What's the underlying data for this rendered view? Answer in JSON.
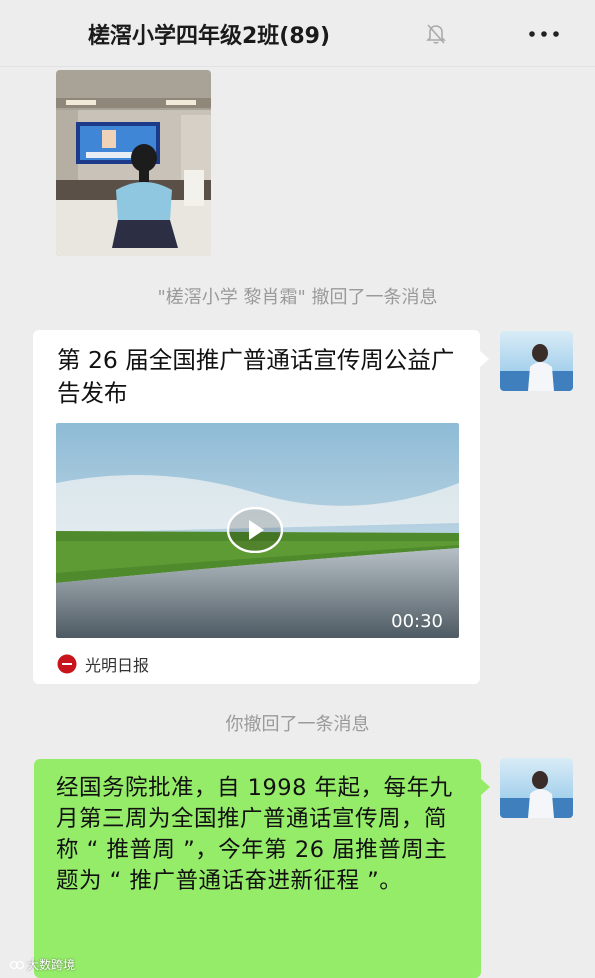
{
  "header": {
    "title": "槎滘小学四年级2班(89)",
    "mute_icon": "mute-bell-icon",
    "more_icon": "more-dots-icon"
  },
  "messages": {
    "recall_other": "\"槎滘小学  黎肖霜\" 撤回了一条消息",
    "recall_self": "你撤回了一条消息",
    "video_card": {
      "title": "第 26 届全国推广普通话宣传周公益广告发布",
      "duration": "00:30",
      "source": "光明日报"
    },
    "text": "经国务院批准，自 1998 年起，每年九月第三周为全国推广普通话宣传周，简称 “ 推普周 ”，今年第 26 届推普周主题为 “ 推广普通话奋进新征程 ”。"
  },
  "watermark": {
    "text": "大数跨境"
  },
  "colors": {
    "background": "#ededed",
    "bubble_green": "#95ec69",
    "card_white": "#ffffff",
    "system_text": "#9a9a9a"
  }
}
